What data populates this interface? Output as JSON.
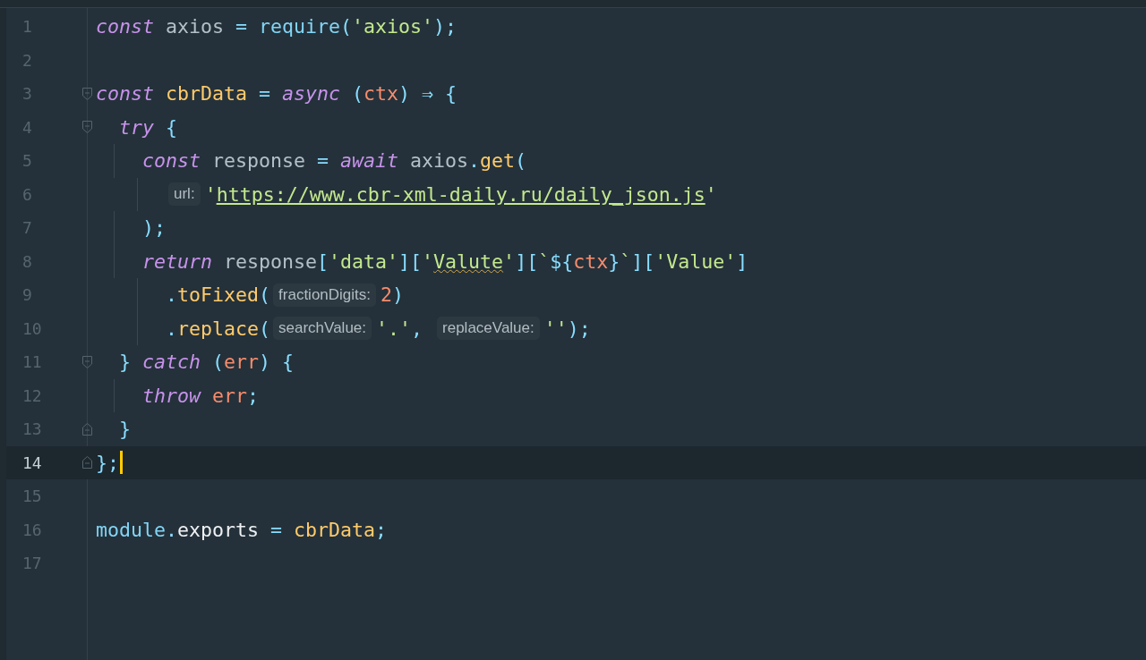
{
  "editor": {
    "lines": [
      {
        "number": "1",
        "current": false,
        "tokens": [
          {
            "text": "const",
            "kind": "keyword"
          },
          {
            "text": " axios ",
            "kind": "plain"
          },
          {
            "text": "=",
            "kind": "punct"
          },
          {
            "text": " require",
            "kind": "function"
          },
          {
            "text": "(",
            "kind": "punct"
          },
          {
            "text": "'axios'",
            "kind": "string"
          },
          {
            "text": ");",
            "kind": "punct"
          }
        ]
      },
      {
        "number": "2",
        "current": false
      },
      {
        "number": "3",
        "current": false,
        "fold_start": true,
        "tokens": [
          {
            "text": "const",
            "kind": "keyword"
          },
          {
            "text": " cbrData ",
            "kind": "definition"
          },
          {
            "text": "= ",
            "kind": "punct"
          },
          {
            "text": "async",
            "kind": "keyword"
          },
          {
            "text": " (",
            "kind": "punct"
          },
          {
            "text": "ctx",
            "kind": "param"
          },
          {
            "text": ") ⇒ {",
            "kind": "punct"
          }
        ]
      },
      {
        "number": "4",
        "current": false,
        "fold_start": true,
        "indent": [
          {
            "guide": false
          }
        ],
        "tokens": [
          {
            "text": "try",
            "kind": "keyword"
          },
          {
            "text": " {",
            "kind": "punct"
          }
        ]
      },
      {
        "number": "5",
        "current": false,
        "indent": [
          {
            "guide": true
          },
          {
            "guide": false
          }
        ],
        "tokens": [
          {
            "text": "const",
            "kind": "keyword"
          },
          {
            "text": " response ",
            "kind": "plain"
          },
          {
            "text": "= ",
            "kind": "punct"
          },
          {
            "text": "await",
            "kind": "keyword"
          },
          {
            "text": " axios",
            "kind": "plain"
          },
          {
            "text": ".",
            "kind": "punct"
          },
          {
            "text": "get",
            "kind": "method"
          },
          {
            "text": "(",
            "kind": "punct"
          }
        ]
      },
      {
        "number": "6",
        "current": false,
        "indent": [
          {
            "guide": false
          },
          {
            "guide": true
          },
          {
            "guide": false
          }
        ],
        "tokens": [
          {
            "text": "url:",
            "kind": "hint"
          },
          {
            "text": "'",
            "kind": "string"
          },
          {
            "text": "https://www.cbr-xml-daily.ru/daily_json.js",
            "kind": "url"
          },
          {
            "text": "'",
            "kind": "string"
          }
        ]
      },
      {
        "number": "7",
        "current": false,
        "indent": [
          {
            "guide": true
          },
          {
            "guide": false
          }
        ],
        "tokens": [
          {
            "text": ");",
            "kind": "punct"
          }
        ]
      },
      {
        "number": "8",
        "current": false,
        "indent": [
          {
            "guide": true
          },
          {
            "guide": false
          }
        ],
        "tokens": [
          {
            "text": "return",
            "kind": "keyword"
          },
          {
            "text": " response",
            "kind": "plain"
          },
          {
            "text": "[",
            "kind": "punct"
          },
          {
            "text": "'data'",
            "kind": "string"
          },
          {
            "text": "][",
            "kind": "punct"
          },
          {
            "text": "'",
            "kind": "string"
          },
          {
            "text": "Valute",
            "kind": "string",
            "warning": true
          },
          {
            "text": "'",
            "kind": "string"
          },
          {
            "text": "][",
            "kind": "punct"
          },
          {
            "text": "`",
            "kind": "string"
          },
          {
            "text": "${",
            "kind": "punct"
          },
          {
            "text": "ctx",
            "kind": "param"
          },
          {
            "text": "}",
            "kind": "punct"
          },
          {
            "text": "`",
            "kind": "string"
          },
          {
            "text": "][",
            "kind": "punct"
          },
          {
            "text": "'Value'",
            "kind": "string"
          },
          {
            "text": "]",
            "kind": "punct"
          }
        ]
      },
      {
        "number": "9",
        "current": false,
        "indent": [
          {
            "guide": false
          },
          {
            "guide": true
          },
          {
            "guide": false
          }
        ],
        "tokens": [
          {
            "text": ".",
            "kind": "punct"
          },
          {
            "text": "toFixed",
            "kind": "method"
          },
          {
            "text": "(",
            "kind": "punct"
          },
          {
            "text": "fractionDigits:",
            "kind": "hint"
          },
          {
            "text": "2",
            "kind": "number"
          },
          {
            "text": ")",
            "kind": "punct"
          }
        ]
      },
      {
        "number": "10",
        "current": false,
        "indent": [
          {
            "guide": false
          },
          {
            "guide": true
          },
          {
            "guide": false
          }
        ],
        "tokens": [
          {
            "text": ".",
            "kind": "punct"
          },
          {
            "text": "replace",
            "kind": "method"
          },
          {
            "text": "(",
            "kind": "punct"
          },
          {
            "text": "searchValue:",
            "kind": "hint"
          },
          {
            "text": "'.'",
            "kind": "string"
          },
          {
            "text": ", ",
            "kind": "punct"
          },
          {
            "text": "replaceValue:",
            "kind": "hint"
          },
          {
            "text": "''",
            "kind": "string"
          },
          {
            "text": ");",
            "kind": "punct"
          }
        ]
      },
      {
        "number": "11",
        "current": false,
        "fold_start": true,
        "indent": [
          {
            "guide": false
          }
        ],
        "tokens": [
          {
            "text": "} ",
            "kind": "punct"
          },
          {
            "text": "catch",
            "kind": "keyword"
          },
          {
            "text": " (",
            "kind": "punct"
          },
          {
            "text": "err",
            "kind": "param"
          },
          {
            "text": ") {",
            "kind": "punct"
          }
        ]
      },
      {
        "number": "12",
        "current": false,
        "indent": [
          {
            "guide": true
          },
          {
            "guide": false
          }
        ],
        "tokens": [
          {
            "text": "throw",
            "kind": "keyword"
          },
          {
            "text": " err",
            "kind": "param"
          },
          {
            "text": ";",
            "kind": "punct"
          }
        ]
      },
      {
        "number": "13",
        "current": false,
        "fold_end": true,
        "indent": [
          {
            "guide": false
          }
        ],
        "tokens": [
          {
            "text": "}",
            "kind": "punct"
          }
        ]
      },
      {
        "number": "14",
        "current": true,
        "fold_end": true,
        "tokens": [
          {
            "text": "};",
            "kind": "punct"
          }
        ]
      },
      {
        "number": "15",
        "current": false
      },
      {
        "number": "16",
        "current": false,
        "tokens": [
          {
            "text": "module",
            "kind": "function"
          },
          {
            "text": ".",
            "kind": "punct"
          },
          {
            "text": "exports ",
            "kind": "bright"
          },
          {
            "text": "= ",
            "kind": "punct"
          },
          {
            "text": "cbrData",
            "kind": "definition"
          },
          {
            "text": ";",
            "kind": "punct"
          }
        ]
      },
      {
        "number": "17",
        "current": false
      }
    ]
  }
}
